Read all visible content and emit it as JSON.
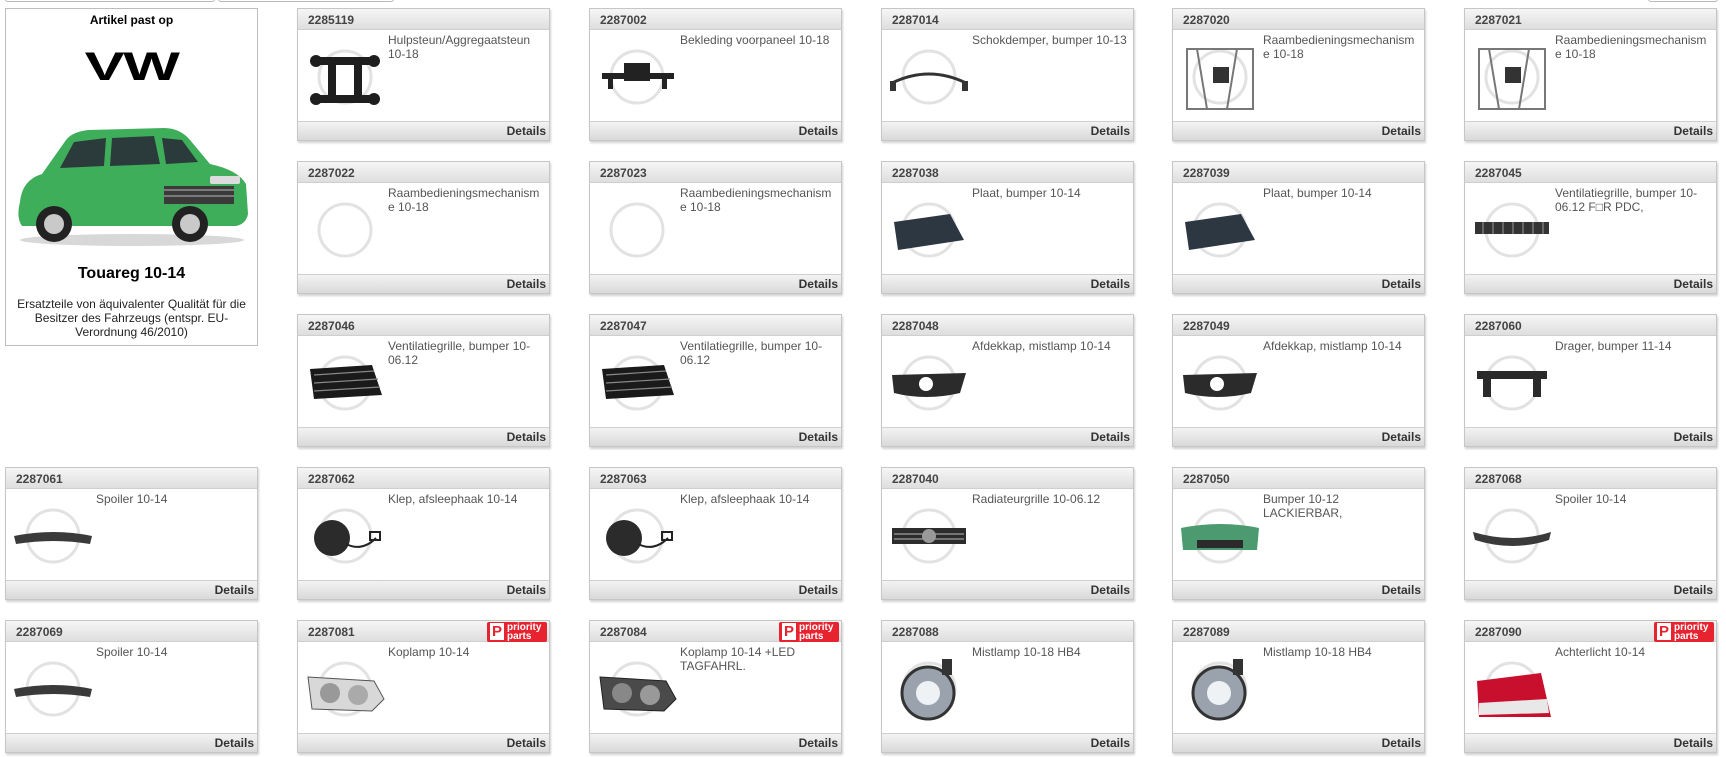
{
  "info": {
    "heading": "Artikel past op",
    "brand": "VW",
    "model": "Touareg 10-14",
    "description": "Ersatzteile von äquivalenter Qualität für die Besitzer des Fahrzeugs (entspr. EU-Verordnung 46/2010)",
    "car_color": "#3fae5a"
  },
  "details_label": "Details",
  "priority_badge": {
    "line1": "priority",
    "line2": "parts",
    "color": "#e6232f"
  },
  "products": [
    {
      "num": "2285119",
      "name": "Hulpsteun/Aggregaatsteun 10-18",
      "icon": "subframe",
      "priority": false
    },
    {
      "num": "2287002",
      "name": "Bekleding voorpaneel 10-18",
      "icon": "panel-bracket",
      "priority": false
    },
    {
      "num": "2287014",
      "name": "Schokdemper, bumper 10-13",
      "icon": "absorber",
      "priority": false
    },
    {
      "num": "2287020",
      "name": "Raambedieningsmechanisme 10-18",
      "icon": "window-regulator",
      "priority": false
    },
    {
      "num": "2287021",
      "name": "Raambedieningsmechanisme 10-18",
      "icon": "window-regulator",
      "priority": false
    },
    {
      "num": "2287022",
      "name": "Raambedieningsmechanisme 10-18",
      "icon": "none",
      "priority": false
    },
    {
      "num": "2287023",
      "name": "Raambedieningsmechanisme 10-18",
      "icon": "none",
      "priority": false
    },
    {
      "num": "2287038",
      "name": "Plaat, bumper 10-14",
      "icon": "plate",
      "priority": false
    },
    {
      "num": "2287039",
      "name": "Plaat, bumper 10-14",
      "icon": "plate",
      "priority": false
    },
    {
      "num": "2287045",
      "name": "Ventilatiegrille, bumper 10-06.12 F□R PDC,",
      "icon": "grille-wide",
      "priority": false
    },
    {
      "num": "2287046",
      "name": "Ventilatiegrille, bumper 10-06.12",
      "icon": "vent-grille",
      "priority": false
    },
    {
      "num": "2287047",
      "name": "Ventilatiegrille, bumper 10-06.12",
      "icon": "vent-grille",
      "priority": false
    },
    {
      "num": "2287048",
      "name": "Afdekkap, mistlamp 10-14",
      "icon": "fog-cover",
      "priority": false
    },
    {
      "num": "2287049",
      "name": "Afdekkap, mistlamp 10-14",
      "icon": "fog-cover",
      "priority": false
    },
    {
      "num": "2287060",
      "name": "Drager, bumper 11-14",
      "icon": "carrier",
      "priority": false
    },
    {
      "num": "2287061",
      "name": "Spoiler 10-14",
      "icon": "spoiler",
      "priority": false
    },
    {
      "num": "2287062",
      "name": "Klep, afsleephaak 10-14",
      "icon": "tow-cap",
      "priority": false
    },
    {
      "num": "2287063",
      "name": "Klep, afsleephaak 10-14",
      "icon": "tow-cap",
      "priority": false
    },
    {
      "num": "2287040",
      "name": "Radiateurgrille 10-06.12",
      "icon": "radiator-grille",
      "priority": false
    },
    {
      "num": "2287050",
      "name": "Bumper 10-12 LACKIERBAR,",
      "icon": "bumper",
      "priority": false
    },
    {
      "num": "2287068",
      "name": "Spoiler 10-14",
      "icon": "spoiler-long",
      "priority": false
    },
    {
      "num": "2287069",
      "name": "Spoiler 10-14",
      "icon": "spoiler",
      "priority": false
    },
    {
      "num": "2287081",
      "name": "Koplamp 10-14",
      "icon": "headlamp",
      "priority": true
    },
    {
      "num": "2287084",
      "name": "Koplamp 10-14 +LED TAGFAHRL.",
      "icon": "headlamp-dark",
      "priority": true
    },
    {
      "num": "2287088",
      "name": "Mistlamp 10-18 HB4",
      "icon": "fog-lamp",
      "priority": false
    },
    {
      "num": "2287089",
      "name": "Mistlamp 10-18 HB4",
      "icon": "fog-lamp",
      "priority": false
    },
    {
      "num": "2287090",
      "name": "Achterlicht 10-14",
      "icon": "tail-light",
      "priority": true
    }
  ]
}
